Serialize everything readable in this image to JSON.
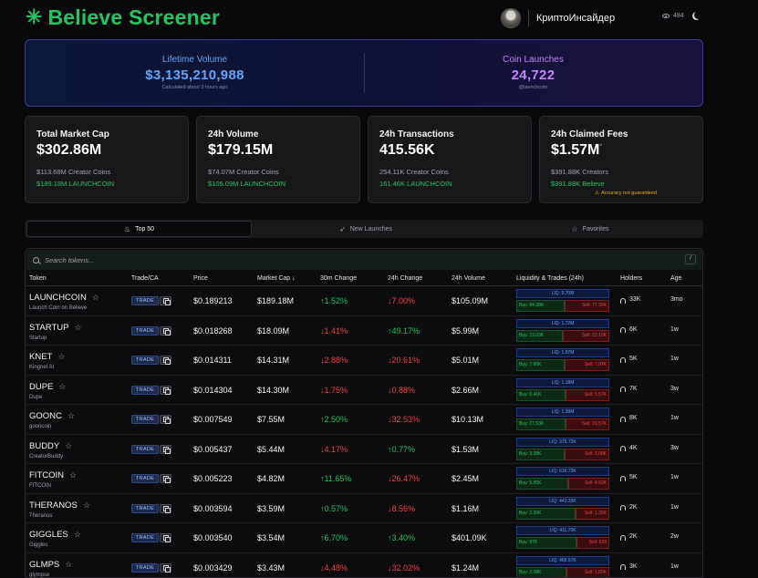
{
  "header": {
    "logo_symbol": "✳",
    "logo_text": "Believe Screener",
    "user_name": "КриптоИнсайдер",
    "view_count": "484"
  },
  "hero": {
    "left": {
      "label": "Lifetime Volume",
      "value": "$3,135,210,988",
      "sub": "Calculated about 3 hours ago"
    },
    "right": {
      "label": "Coin Launches",
      "value": "24,722",
      "sub": "@launchcoin"
    }
  },
  "stats": [
    {
      "label": "Total Market Cap",
      "value": "$302.86M",
      "line1": "$113.68M Creator Coins",
      "line2": "$189.18M LAUNCHCOIN"
    },
    {
      "label": "24h Volume",
      "value": "$179.15M",
      "line1": "$74.07M Creator Coins",
      "line2": "$105.09M LAUNCHCOIN"
    },
    {
      "label": "24h Transactions",
      "value": "415.56K",
      "line1": "254.11K Creator Coins",
      "line2": "161.46K LAUNCHCOIN"
    },
    {
      "label": "24h Claimed Fees",
      "value": "$1.57M",
      "value_mark": "*",
      "line1": "$391.88K Creators",
      "line2": "$391.88K Believe",
      "warning": "Accuracy not guaranteed"
    }
  ],
  "tabs": [
    {
      "label": "Top 50",
      "icon": "fire-icon"
    },
    {
      "label": "New Launches",
      "icon": "rocket-icon"
    },
    {
      "label": "Favorites",
      "icon": "star-icon"
    }
  ],
  "search": {
    "placeholder": "Search tokens...",
    "shortcut": "/"
  },
  "columns": {
    "token": "Token",
    "trade": "Trade/CA",
    "price": "Price",
    "mcap": "Market Cap ↓",
    "change30m": "30m Change",
    "change24h": "24h Change",
    "volume": "24h Volume",
    "liquidity": "Liquidity & Trades (24h)",
    "holders": "Holders",
    "age": "Age"
  },
  "trade_label": "TRADE",
  "rows": [
    {
      "name": "LAUNCHCOIN",
      "sub": "Launch Coin on Believe",
      "price": "$0.189213",
      "mcap": "$189.18M",
      "c30": "↑1.52%",
      "c30_dir": "up",
      "c24": "↓7.00%",
      "c24_dir": "down",
      "vol": "$105.09M",
      "liq": "LIQ: 9.70M",
      "buy": "Buy: 84.38K",
      "sell": "Sell: 77.30K",
      "buy_share": 0.52,
      "holders": "33K",
      "age": "3mo"
    },
    {
      "name": "STARTUP",
      "sub": "Startup",
      "price": "$0.018268",
      "mcap": "$18.09M",
      "c30": "↓1.41%",
      "c30_dir": "down",
      "c24": "↑49.17%",
      "c24_dir": "up",
      "vol": "$5.99M",
      "liq": "LIQ: 1.72M",
      "buy": "Buy: 13.03K",
      "sell": "Sell: 13.10K",
      "buy_share": 0.5,
      "holders": "6K",
      "age": "1w"
    },
    {
      "name": "KNET",
      "sub": "Kingnet AI",
      "price": "$0.014311",
      "mcap": "$14.31M",
      "c30": "↓2.88%",
      "c30_dir": "down",
      "c24": "↓20.61%",
      "c24_dir": "down",
      "vol": "$5.01M",
      "liq": "LIQ: 1.97M",
      "buy": "Buy: 7.80K",
      "sell": "Sell: 7.07K",
      "buy_share": 0.52,
      "holders": "5K",
      "age": "1w"
    },
    {
      "name": "DUPE",
      "sub": "Dupe",
      "price": "$0.014304",
      "mcap": "$14.30M",
      "c30": "↓1.75%",
      "c30_dir": "down",
      "c24": "↓0.88%",
      "c24_dir": "down",
      "vol": "$2.66M",
      "liq": "LIQ: 1.18M",
      "buy": "Buy: 6.41K",
      "sell": "Sell: 5.57K",
      "buy_share": 0.53,
      "holders": "7K",
      "age": "3w"
    },
    {
      "name": "GOONC",
      "sub": "gooncoin",
      "price": "$0.007549",
      "mcap": "$7.55M",
      "c30": "↑2.50%",
      "c30_dir": "up",
      "c24": "↓32.53%",
      "c24_dir": "down",
      "vol": "$10.13M",
      "liq": "LIQ: 1.38M",
      "buy": "Buy: 17.53K",
      "sell": "Sell: 15.57K",
      "buy_share": 0.53,
      "holders": "8K",
      "age": "1w"
    },
    {
      "name": "BUDDY",
      "sub": "CreatorBuddy",
      "price": "$0.005437",
      "mcap": "$5.44M",
      "c30": "↓4.17%",
      "c30_dir": "down",
      "c24": "↑0.77%",
      "c24_dir": "up",
      "vol": "$1.53M",
      "liq": "LIQ: 375.72K",
      "buy": "Buy: 3.38K",
      "sell": "Sell: 3.08K",
      "buy_share": 0.52,
      "holders": "4K",
      "age": "3w"
    },
    {
      "name": "FITCOIN",
      "sub": "FITCOIN",
      "price": "$0.005223",
      "mcap": "$4.82M",
      "c30": "↑11.65%",
      "c30_dir": "up",
      "c24": "↓26.47%",
      "c24_dir": "down",
      "vol": "$2.45M",
      "liq": "LIQ: 616.73K",
      "buy": "Buy: 5.85K",
      "sell": "Sell: 4.62K",
      "buy_share": 0.56,
      "holders": "5K",
      "age": "1w"
    },
    {
      "name": "THERANOS",
      "sub": "Theranos",
      "price": "$0.003594",
      "mcap": "$3.59M",
      "c30": "↑0.57%",
      "c30_dir": "up",
      "c24": "↓8.56%",
      "c24_dir": "down",
      "vol": "$1.16M",
      "liq": "LIQ: 443.33K",
      "buy": "Buy: 2.30K",
      "sell": "Sell: 1.32K",
      "buy_share": 0.64,
      "holders": "2K",
      "age": "1w"
    },
    {
      "name": "GIGGLES",
      "sub": "Giggles",
      "price": "$0.003540",
      "mcap": "$3.54M",
      "c30": "↑6.70%",
      "c30_dir": "up",
      "c24": "↑3.40%",
      "c24_dir": "up",
      "vol": "$401.09K",
      "liq": "LIQ: 411.70K",
      "buy": "Buy: 978",
      "sell": "Sell: 538",
      "buy_share": 0.65,
      "holders": "2K",
      "age": "2w"
    },
    {
      "name": "GLMPS",
      "sub": "glympse",
      "price": "$0.003429",
      "mcap": "$3.43M",
      "c30": "↓4.48%",
      "c30_dir": "down",
      "c24": "↓32.02%",
      "c24_dir": "down",
      "vol": "$1.24M",
      "liq": "LIQ: 465.57K",
      "buy": "Buy: 2.08K",
      "sell": "Sell: 1.80K",
      "buy_share": 0.54,
      "holders": "3K",
      "age": "1w"
    }
  ],
  "colors": {
    "brand": "#22c55e",
    "up": "#22c55e",
    "down": "#ef4444",
    "hero_blue": "#60a5fa",
    "hero_purple": "#c084fc",
    "background": "#09090b"
  }
}
